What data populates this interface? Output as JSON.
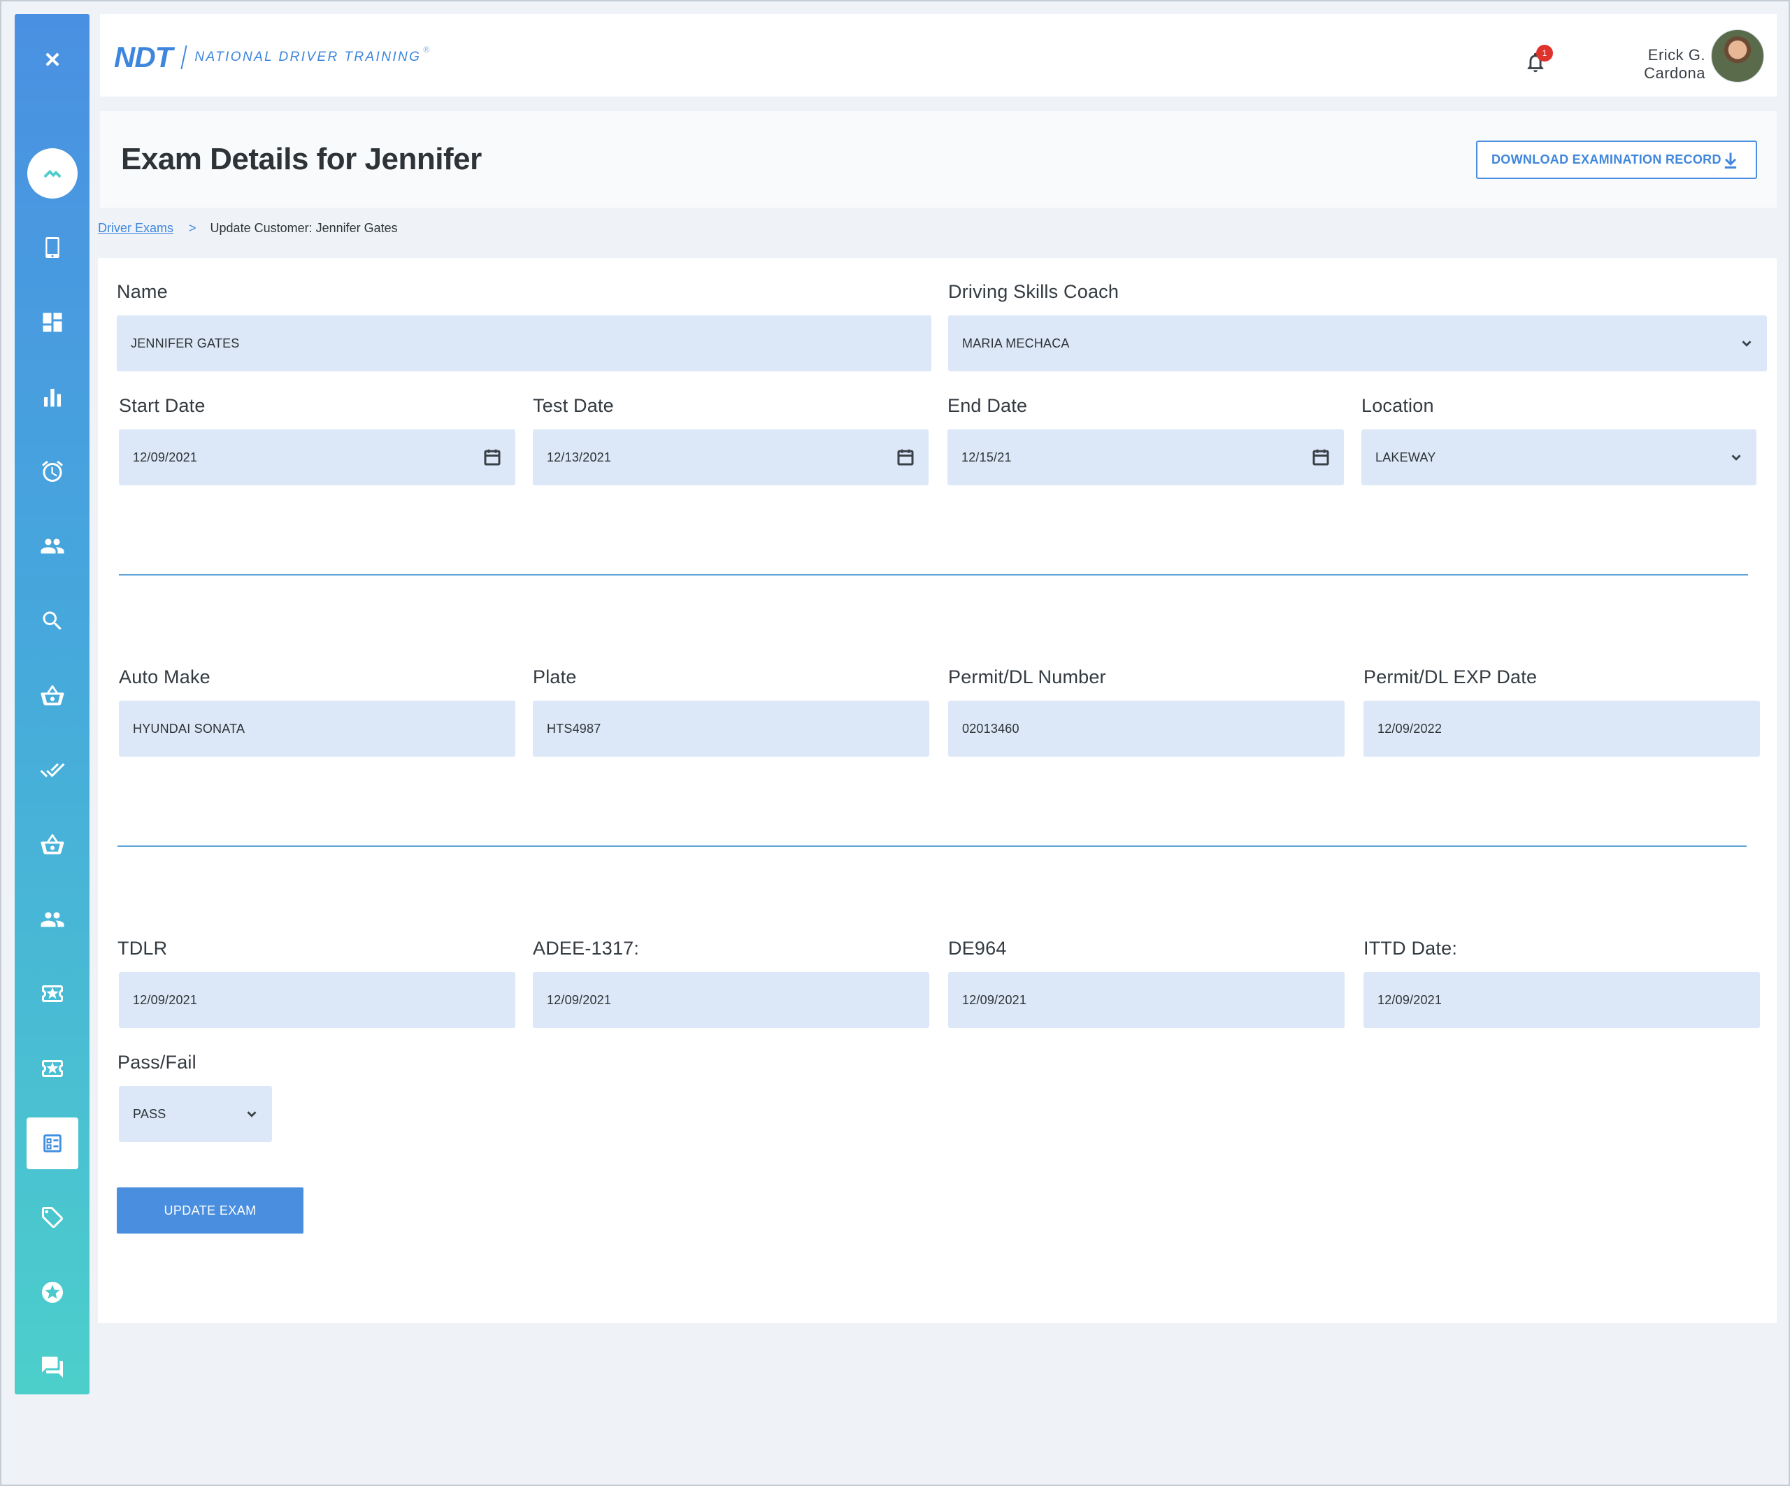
{
  "brand": {
    "mark": "NDT",
    "name": "NATIONAL DRIVER TRAINING",
    "reg": "®"
  },
  "header": {
    "notification_count": "1",
    "user_first": "Erick G.",
    "user_last": "Cardona"
  },
  "page": {
    "title": "Exam Details for Jennifer",
    "download_label": "DOWNLOAD EXAMINATION RECORD"
  },
  "breadcrumb": {
    "parent": "Driver Exams",
    "separator": ">",
    "current": "Update Customer: Jennifer Gates"
  },
  "sidebar": {
    "items": [
      "close-icon",
      "home-icon",
      "mobile-icon",
      "dashboard-icon",
      "bar-chart-icon",
      "alarm-icon",
      "people-icon",
      "search-icon",
      "basket-icon",
      "double-check-icon",
      "basket-icon",
      "people-icon",
      "ticket-star-icon",
      "ticket-star-icon",
      "form-list-icon",
      "tag-icon",
      "star-badge-icon",
      "chat-icon"
    ],
    "active_index": 14
  },
  "form": {
    "name": {
      "label": "Name",
      "value": "JENNIFER GATES"
    },
    "coach": {
      "label": "Driving Skills Coach",
      "value": "MARIA MECHACA"
    },
    "start_date": {
      "label": "Start Date",
      "value": "12/09/2021"
    },
    "test_date": {
      "label": "Test Date",
      "value": "12/13/2021"
    },
    "end_date": {
      "label": "End Date",
      "value": "12/15/21"
    },
    "location": {
      "label": "Location",
      "value": "LAKEWAY"
    },
    "auto_make": {
      "label": "Auto Make",
      "value": "HYUNDAI SONATA"
    },
    "plate": {
      "label": "Plate",
      "value": "HTS4987"
    },
    "permit_number": {
      "label": "Permit/DL Number",
      "value": "02013460"
    },
    "permit_exp": {
      "label": "Permit/DL EXP Date",
      "value": "12/09/2022"
    },
    "tdlr": {
      "label": "TDLR",
      "value": "12/09/2021"
    },
    "adee": {
      "label": "ADEE-1317:",
      "value": "12/09/2021"
    },
    "de964": {
      "label": "DE964",
      "value": "12/09/2021"
    },
    "ittd": {
      "label": "ITTD Date:",
      "value": "12/09/2021"
    },
    "pass_fail": {
      "label": "Pass/Fail",
      "value": "PASS"
    },
    "submit_label": "UPDATE EXAM"
  },
  "colors": {
    "accent": "#4a8ee0",
    "input_bg": "#dce8f7",
    "sidebar_top": "#4a90e2",
    "sidebar_bottom": "#4ccfcb",
    "badge": "#e0322c"
  }
}
